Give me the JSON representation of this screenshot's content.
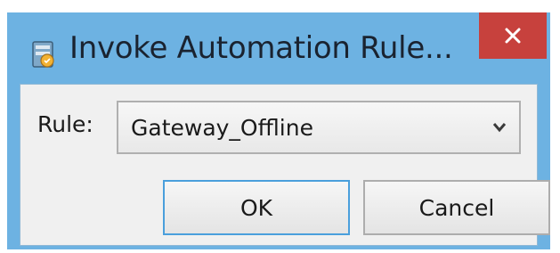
{
  "window": {
    "title": "Invoke Automation Rule...",
    "icon": "automation-rule-icon",
    "frame_color": "#6db2e2",
    "close_color": "#c7413d"
  },
  "form": {
    "rule_label": "Rule:",
    "rule_value": "Gateway_Offline"
  },
  "buttons": {
    "ok_label": "OK",
    "cancel_label": "Cancel"
  }
}
